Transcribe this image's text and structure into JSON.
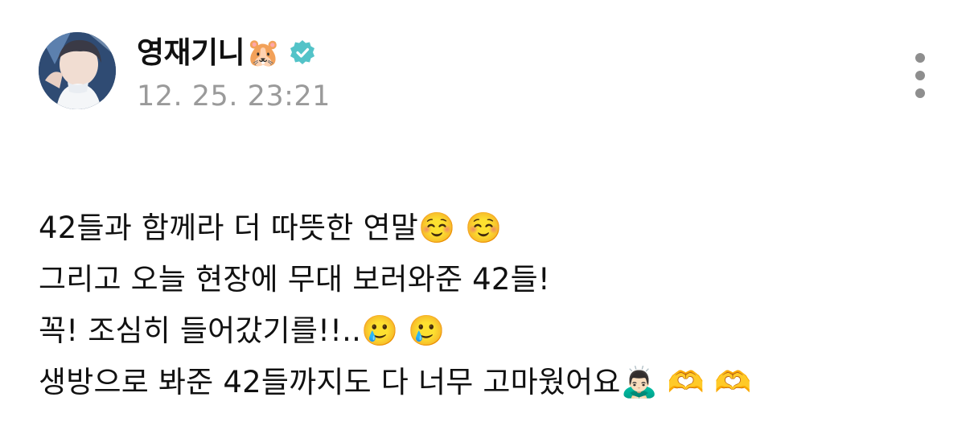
{
  "post": {
    "author": {
      "name": "영재기니",
      "name_emoji": "🐹",
      "verified": true,
      "avatar_icon": "profile-photo"
    },
    "timestamp": "12. 25. 23:21",
    "more_icon": "vertical-ellipsis-icon",
    "lines": [
      "42들과 함께라 더 따뜻한 연말☺️ ☺️",
      "그리고 오늘 현장에 무대 보러와준 42들!",
      "꼭! 조심히 들어갔기를!!..🥲 🥲",
      "생방으로 봐준 42들까지도 다 너무 고마웠어요🙇🏻‍♂️ 🫶 🫶"
    ]
  },
  "colors": {
    "text": "#111111",
    "timestamp": "#9a9a9a",
    "verified_badge": "#53c3c8",
    "more_dots": "#8e8e8e",
    "background": "#ffffff"
  }
}
